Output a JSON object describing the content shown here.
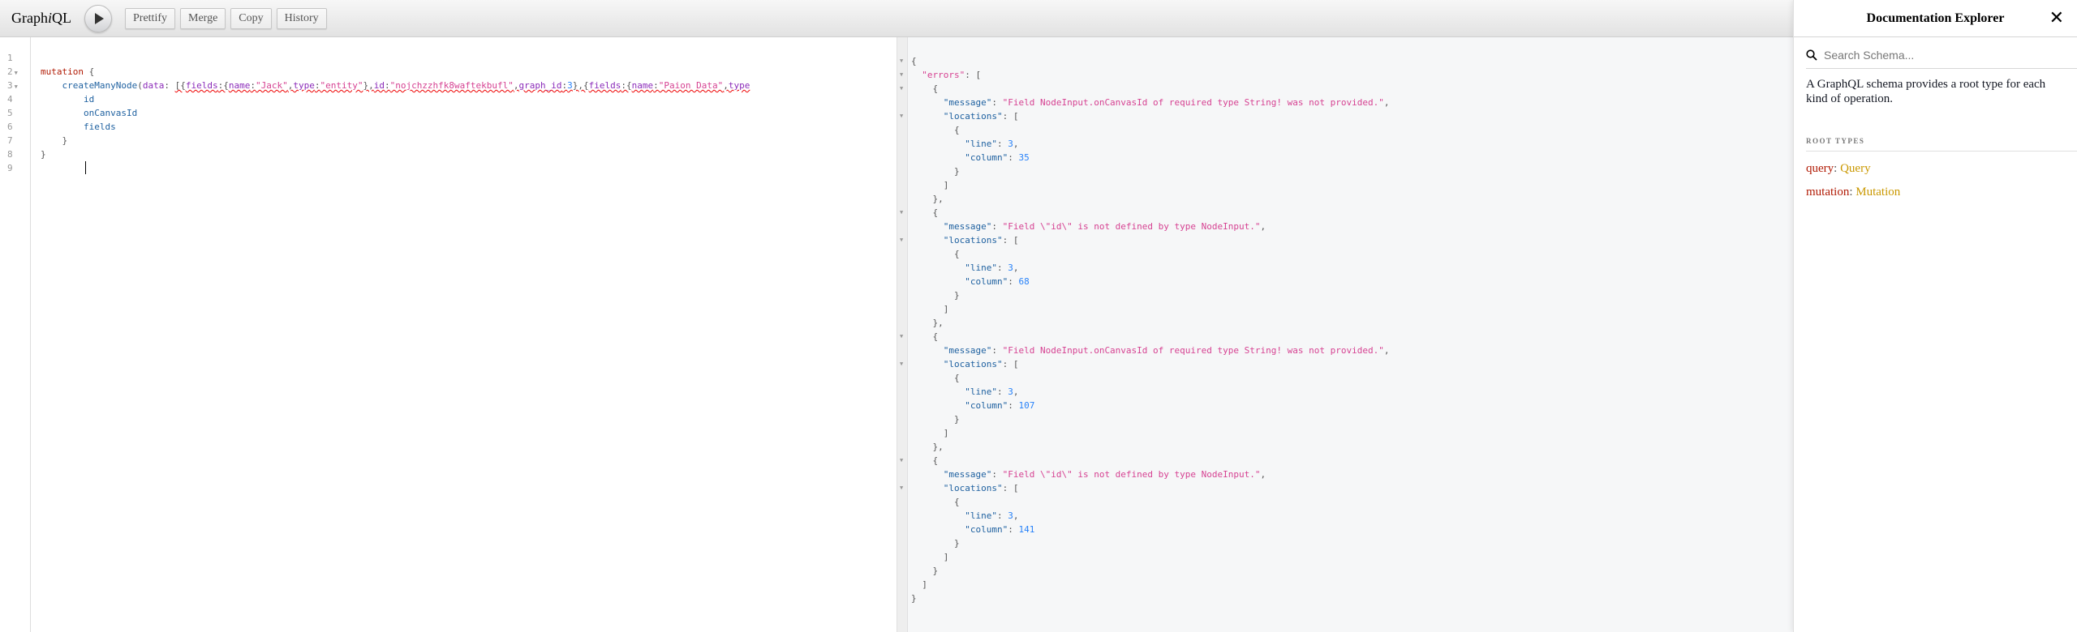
{
  "toolbar": {
    "title_prefix": "Graph",
    "title_i": "i",
    "title_suffix": "QL",
    "buttons": [
      "Prettify",
      "Merge",
      "Copy",
      "History"
    ]
  },
  "editor": {
    "lines": [
      [],
      [
        [
          "mutation",
          "kw"
        ],
        [
          " {",
          "punc"
        ]
      ],
      [
        [
          "    ",
          ""
        ],
        [
          "createManyNode",
          "def"
        ],
        [
          "(",
          "punc"
        ],
        [
          "data",
          "attr"
        ],
        [
          ": ",
          "punc"
        ],
        [
          "[{",
          "punc squig"
        ],
        [
          "fields",
          "attr squig"
        ],
        [
          ":{",
          "punc squig"
        ],
        [
          "name",
          "attr squig"
        ],
        [
          ":",
          "punc squig"
        ],
        [
          "\"Jack\"",
          "str squig"
        ],
        [
          ",",
          "punc squig"
        ],
        [
          "type",
          "attr squig"
        ],
        [
          ":",
          "punc squig"
        ],
        [
          "\"entity\"",
          "str squig"
        ],
        [
          "},",
          "punc squig"
        ],
        [
          "id",
          "attr squig"
        ],
        [
          ":",
          "punc squig"
        ],
        [
          "\"nojchzzhfk8waftekbufl\"",
          "str squig"
        ],
        [
          ",",
          "punc squig"
        ],
        [
          "graph_id",
          "attr squig"
        ],
        [
          ":",
          "punc squig"
        ],
        [
          "3",
          "num squig"
        ],
        [
          "},{",
          "punc squig"
        ],
        [
          "fields",
          "attr squig"
        ],
        [
          ":{",
          "punc squig"
        ],
        [
          "name",
          "attr squig"
        ],
        [
          ":",
          "punc squig"
        ],
        [
          "\"Paion Data\"",
          "str squig"
        ],
        [
          ",",
          "punc squig"
        ],
        [
          "type",
          "attr squig"
        ]
      ],
      [
        [
          "        ",
          ""
        ],
        [
          "id",
          "def"
        ]
      ],
      [
        [
          "        ",
          ""
        ],
        [
          "onCanvasId",
          "def"
        ]
      ],
      [
        [
          "        ",
          ""
        ],
        [
          "fields",
          "def"
        ]
      ],
      [
        [
          "    ",
          ""
        ],
        [
          "}",
          "punc"
        ]
      ],
      [
        [
          "}",
          "punc"
        ]
      ],
      []
    ],
    "folds": [
      2,
      3
    ]
  },
  "result": {
    "errors": [
      {
        "message": "Field NodeInput.onCanvasId of required type String! was not provided.",
        "line": 3,
        "column": 35
      },
      {
        "message": "Field \\\"id\\\" is not defined by type NodeInput.",
        "line": 3,
        "column": 68
      },
      {
        "message": "Field NodeInput.onCanvasId of required type String! was not provided.",
        "line": 3,
        "column": 107
      },
      {
        "message": "Field \\\"id\\\" is not defined by type NodeInput.",
        "line": 3,
        "column": 141
      }
    ]
  },
  "docs": {
    "title": "Documentation Explorer",
    "search_placeholder": "Search Schema...",
    "description": "A GraphQL schema provides a root type for each kind of operation.",
    "section": "Root Types",
    "root_types": [
      {
        "field": "query",
        "type": "Query"
      },
      {
        "field": "mutation",
        "type": "Mutation"
      }
    ]
  },
  "colors": {
    "keyword": "#b11a04",
    "string": "#d64292",
    "number": "#2882f9",
    "type": "#ca9800",
    "property": "#1f61a0"
  }
}
